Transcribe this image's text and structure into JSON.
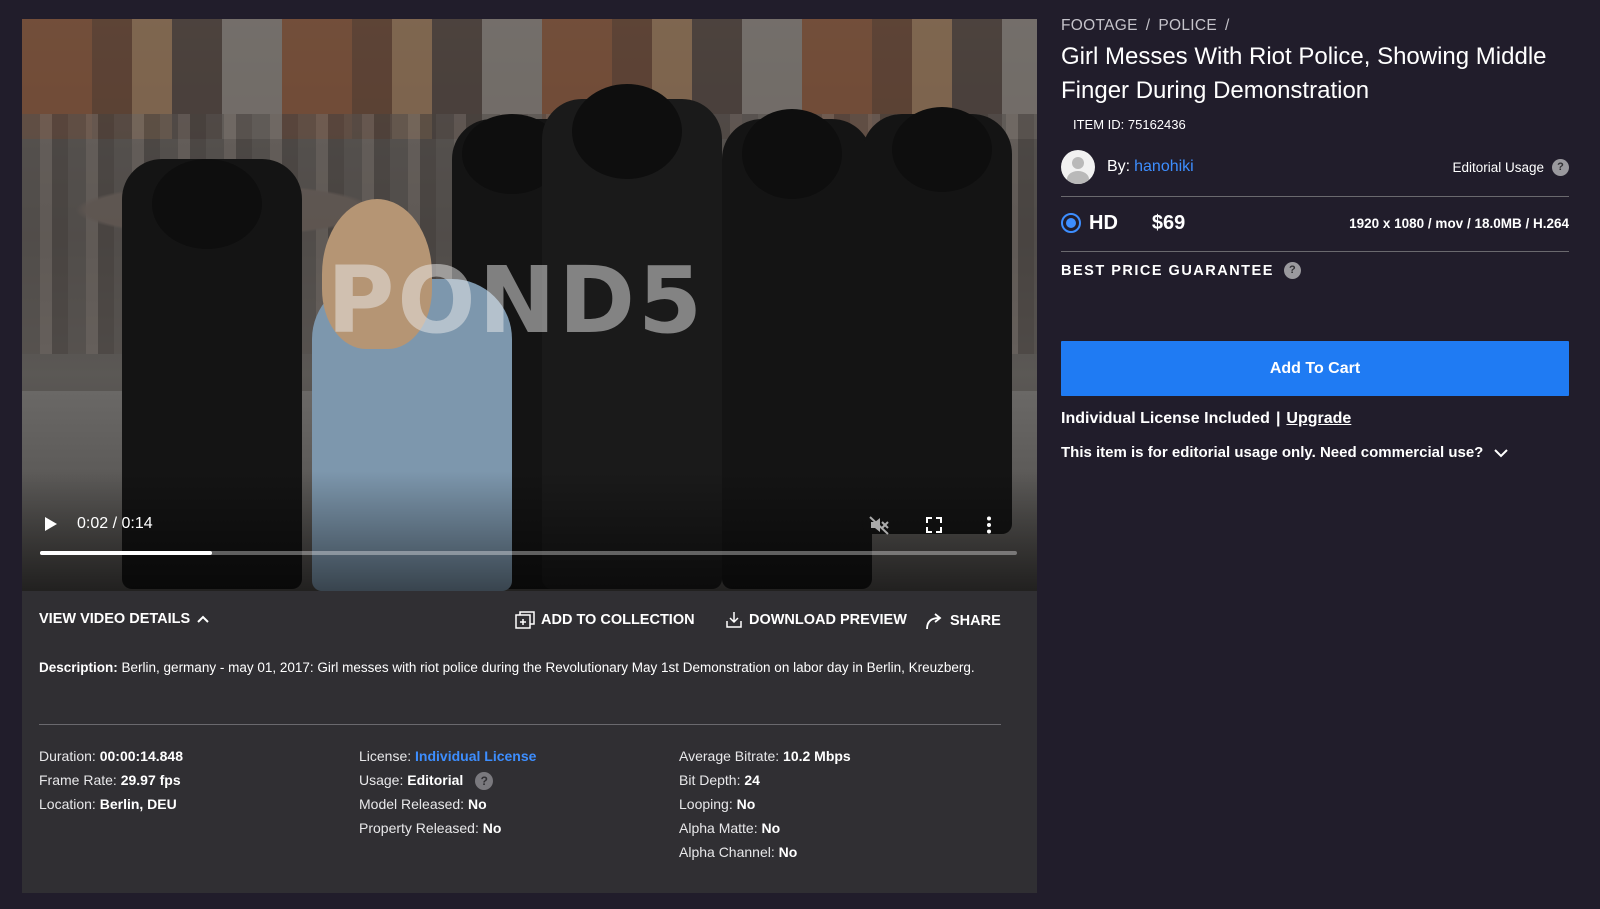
{
  "video": {
    "watermark": "POND5",
    "current_time": "0:02",
    "duration": "0:14",
    "progress": 0.176,
    "icons": [
      "play-icon",
      "mute-icon",
      "fullscreen-icon",
      "more-vert-icon"
    ]
  },
  "details_bar": {
    "view_details": "VIEW VIDEO DETAILS",
    "add_to_collection": "ADD TO COLLECTION",
    "download_preview": "DOWNLOAD PREVIEW",
    "share": "SHARE"
  },
  "description": {
    "label": "Description:",
    "text": "Berlin, germany - may 01, 2017: Girl messes with riot police during the Revolutionary May 1st Demonstration on labor day in Berlin, Kreuzberg."
  },
  "specs": {
    "col1": [
      {
        "label": "Duration:",
        "value": "00:00:14.848"
      },
      {
        "label": "Frame Rate:",
        "value": "29.97 fps"
      },
      {
        "label": "Location:",
        "value": "Berlin, DEU"
      }
    ],
    "col2": [
      {
        "label": "License:",
        "value": "Individual License"
      },
      {
        "label": "Usage:",
        "value": "Editorial"
      },
      {
        "label": "Model Released:",
        "value": "No"
      },
      {
        "label": "Property Released:",
        "value": "No"
      }
    ],
    "col3": [
      {
        "label": "Average Bitrate:",
        "value": "10.2 Mbps"
      },
      {
        "label": "Bit Depth:",
        "value": "24"
      },
      {
        "label": "Looping:",
        "value": "No"
      },
      {
        "label": "Alpha Matte:",
        "value": "No"
      },
      {
        "label": "Alpha Channel:",
        "value": "No"
      }
    ],
    "help_symbol": "?"
  },
  "product": {
    "breadcrumb": [
      "FOOTAGE",
      "/",
      "POLICE",
      "/"
    ],
    "title": "Girl Messes With Riot Police, Showing Middle Finger During Demonstration",
    "item_id": "ITEM ID: 75162436",
    "by_label": "By:",
    "author": "hanohiki",
    "editorial_usage": "Editorial Usage",
    "format": "HD",
    "price": "$69",
    "file_specs": "1920 x 1080 / mov / 18.0MB / H.264",
    "guarantee": "BEST PRICE GUARANTEE",
    "add_to_cart": "Add To Cart",
    "license_included": "Individual License Included",
    "separator": "|",
    "upgrade": "Upgrade",
    "commercial_note": "This item is for editorial usage only. Need commercial use?"
  },
  "colors": {
    "background": "#211d2b",
    "panel": "#302f33",
    "accent": "#1f7bf3",
    "link": "#3d8eff"
  }
}
